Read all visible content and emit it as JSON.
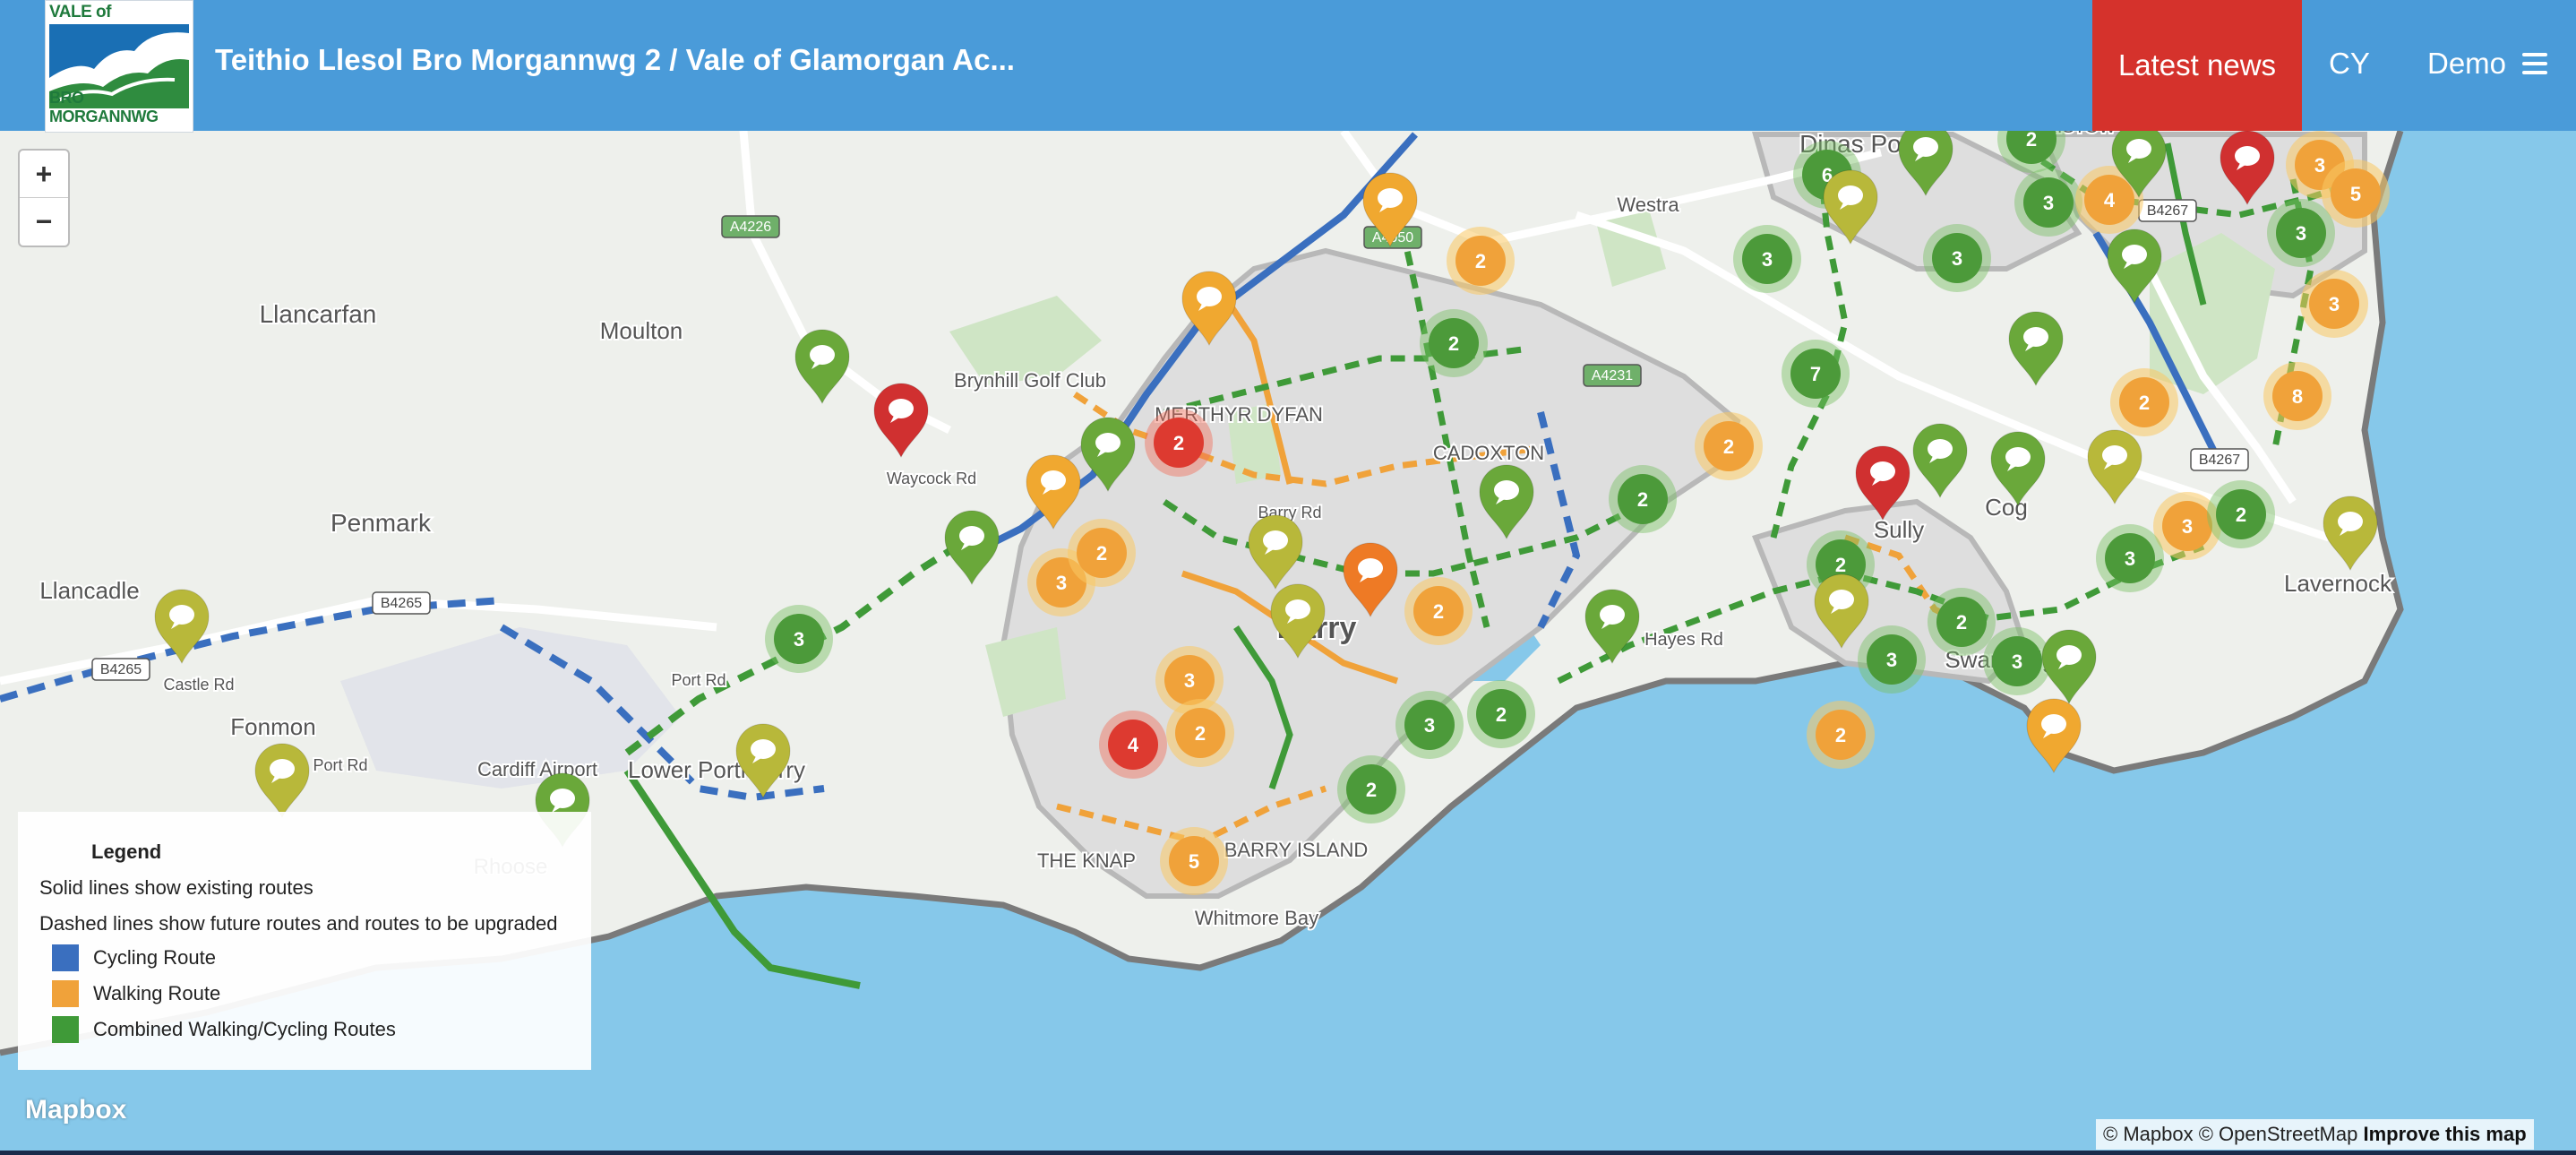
{
  "header": {
    "logo_top": "VALE of GLAMORGAN",
    "logo_bottom": "BRO MORGANNWG",
    "title": "Teithio Llesol Bro Morgannwg 2 / Vale of Glamorgan Ac...",
    "latest_news": "Latest news",
    "language": "CY",
    "demo": "Demo"
  },
  "zoom": {
    "in": "+",
    "out": "−"
  },
  "colors": {
    "header": "#4a9bd9",
    "news": "#d5322c",
    "sea": "#86c8ea",
    "land": "#eef0ec",
    "urban": "#dcdcdc",
    "cycling": "#3a6fbf",
    "walking": "#f0a23a",
    "combined": "#3f9a38",
    "pin_green": "#6aa83a",
    "pin_olive": "#b8b83a",
    "pin_orange": "#f0a830",
    "pin_red": "#d03030"
  },
  "map_labels": [
    "Llancarfan",
    "Moulton",
    "Penmark",
    "Llancadle",
    "Fonmon",
    "Cardiff Airport",
    "Lower Porthkerry",
    "Rhoose",
    "Brynhill Golf Club",
    "MERTHYR DYFAN",
    "CADOXTON",
    "Barry",
    "THE KNAP",
    "BARRY ISLAND",
    "Whitmore Bay",
    "Dinas Powys",
    "Westra",
    "Cog",
    "Sully",
    "Swanbridge",
    "Lavernock",
    "Castle Rd",
    "Port Rd",
    "Port Rd",
    "Hayes Rd",
    "Waycock Rd",
    "Barry Rd",
    "A4226",
    "A4231",
    "A4050",
    "B4265",
    "B4265",
    "B4267",
    "B4267",
    "ESTOWN",
    "RRISTOW"
  ],
  "clusters": [
    {
      "count": "2",
      "type": "orange"
    },
    {
      "count": "2",
      "type": "green"
    },
    {
      "count": "2",
      "type": "red"
    },
    {
      "count": "3",
      "type": "orange"
    },
    {
      "count": "2",
      "type": "orange"
    },
    {
      "count": "3",
      "type": "green"
    },
    {
      "count": "3",
      "type": "orange"
    },
    {
      "count": "2",
      "type": "orange"
    },
    {
      "count": "4",
      "type": "red"
    },
    {
      "count": "2",
      "type": "orange"
    },
    {
      "count": "5",
      "type": "orange"
    },
    {
      "count": "2",
      "type": "green"
    },
    {
      "count": "3",
      "type": "green"
    },
    {
      "count": "2",
      "type": "green"
    },
    {
      "count": "2",
      "type": "orange"
    },
    {
      "count": "2",
      "type": "green"
    },
    {
      "count": "7",
      "type": "green"
    },
    {
      "count": "2",
      "type": "orange"
    },
    {
      "count": "3",
      "type": "green"
    },
    {
      "count": "6",
      "type": "green"
    },
    {
      "count": "2",
      "type": "green"
    },
    {
      "count": "3",
      "type": "green"
    },
    {
      "count": "3",
      "type": "green"
    },
    {
      "count": "4",
      "type": "orange"
    },
    {
      "count": "3",
      "type": "orange"
    },
    {
      "count": "5",
      "type": "orange"
    },
    {
      "count": "3",
      "type": "green"
    },
    {
      "count": "3",
      "type": "orange"
    },
    {
      "count": "2",
      "type": "orange"
    },
    {
      "count": "8",
      "type": "orange"
    },
    {
      "count": "3",
      "type": "orange"
    },
    {
      "count": "2",
      "type": "green"
    },
    {
      "count": "3",
      "type": "green"
    },
    {
      "count": "2",
      "type": "green"
    },
    {
      "count": "2",
      "type": "green"
    },
    {
      "count": "3",
      "type": "green"
    },
    {
      "count": "3",
      "type": "green"
    }
  ],
  "legend": {
    "title": "Legend",
    "line1": "Solid lines show existing routes",
    "line2": "Dashed lines show future routes and routes to be upgraded",
    "items": [
      {
        "label": "Cycling Route",
        "color": "#3a6fbf"
      },
      {
        "label": "Walking Route",
        "color": "#f0a23a"
      },
      {
        "label": "Combined Walking/Cycling Routes",
        "color": "#3f9a38"
      }
    ]
  },
  "mapbox_logo": "Mapbox",
  "attribution": {
    "mapbox": "© Mapbox",
    "osm": "© OpenStreetMap",
    "improve": "Improve this map"
  }
}
